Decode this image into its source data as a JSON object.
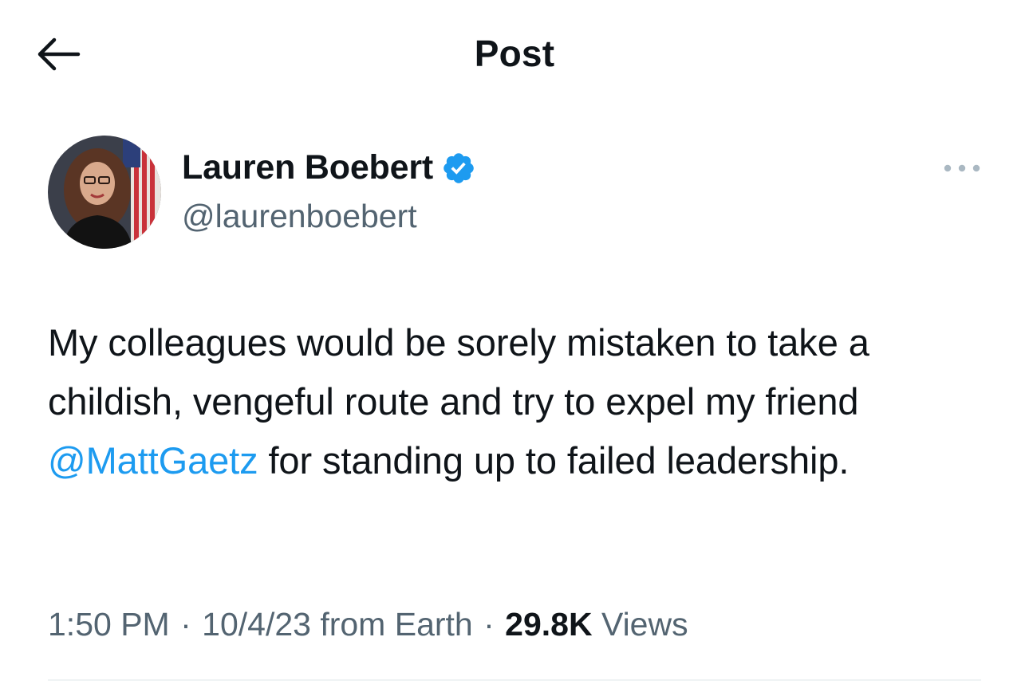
{
  "header": {
    "title": "Post",
    "back_icon": "arrow-left-icon"
  },
  "author": {
    "display_name": "Lauren Boebert",
    "handle": "@laurenboebert",
    "verified_icon": "verified-badge-icon",
    "more_icon": "more-horizontal-icon"
  },
  "post": {
    "text_before": "My colleagues would be sorely mistaken to take a childish, vengeful route and try to expel my friend ",
    "mention": "@MattGaetz",
    "text_after": " for standing up to failed leadership."
  },
  "meta": {
    "time": "1:50 PM",
    "separator": " · ",
    "date": "10/4/23",
    "source": " from Earth",
    "views_count": "29.8K",
    "views_label": " Views"
  },
  "colors": {
    "accent": "#1d9bf0",
    "text_primary": "#0f1419",
    "text_secondary": "#536471"
  }
}
